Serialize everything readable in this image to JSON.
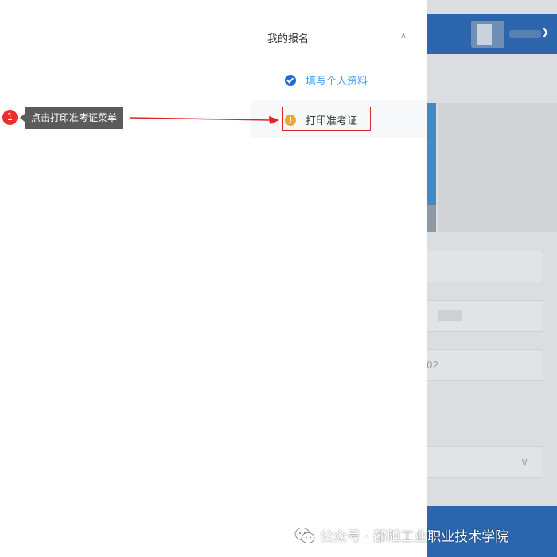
{
  "menu": {
    "title": "我的报名",
    "caret_icon": "chevron-up-icon",
    "items": [
      {
        "label": "填写个人资料",
        "icon": "check-circle-icon",
        "status": "done"
      },
      {
        "label": "打印准考证",
        "icon": "warning-circle-icon",
        "status": "pending"
      }
    ]
  },
  "annotation": {
    "step": "1",
    "text": "点击打印准考证菜单"
  },
  "background": {
    "partial_text": "02"
  },
  "watermark": {
    "text": "公众号 · 邵阳工业职业技术学院",
    "icon": "wechat-icon"
  },
  "colors": {
    "accent_blue": "#409eff",
    "header_blue": "#2c66ad",
    "warning_orange": "#f0a82a",
    "highlight_red": "#e02424"
  }
}
